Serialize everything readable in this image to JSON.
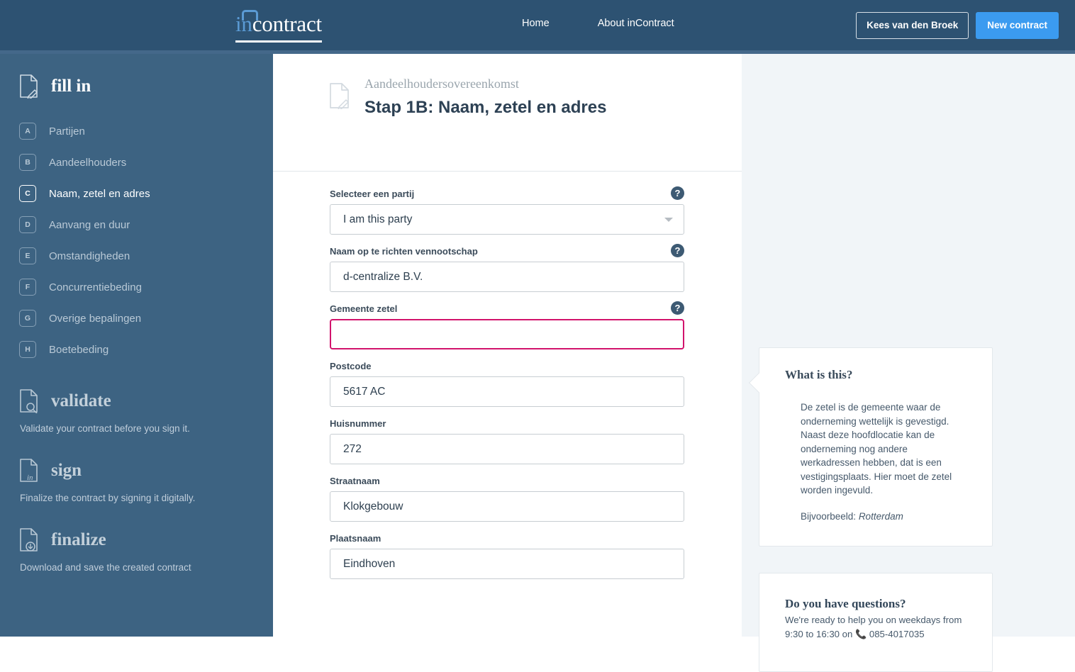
{
  "header": {
    "logo_in": "in",
    "logo_rest": "contract",
    "nav": [
      {
        "label": "Home",
        "name": "nav-home"
      },
      {
        "label": "About inContract",
        "name": "nav-about"
      }
    ],
    "account_button": "Kees van den Broek",
    "new_contract_button": "New contract"
  },
  "sidebar": {
    "fill_in": {
      "title": "fill in",
      "icon": "document-pencil-icon"
    },
    "items": [
      {
        "badge": "A",
        "label": "Partijen",
        "active": false
      },
      {
        "badge": "B",
        "label": "Aandeelhouders",
        "active": false
      },
      {
        "badge": "C",
        "label": "Naam, zetel en adres",
        "active": true
      },
      {
        "badge": "D",
        "label": "Aanvang en duur",
        "active": false
      },
      {
        "badge": "E",
        "label": "Omstandigheden",
        "active": false
      },
      {
        "badge": "F",
        "label": "Concurrentiebeding",
        "active": false
      },
      {
        "badge": "G",
        "label": "Overige bepalingen",
        "active": false
      },
      {
        "badge": "H",
        "label": "Boetebeding",
        "active": false
      }
    ],
    "validate": {
      "title": "validate",
      "description": "Validate your contract before you sign it.",
      "icon": "document-search-icon"
    },
    "sign": {
      "title": "sign",
      "description": "Finalize the contract by signing it digitally.",
      "icon": "document-signature-icon"
    },
    "finalize": {
      "title": "finalize",
      "description": "Download and save the created contract",
      "icon": "document-download-icon"
    }
  },
  "main": {
    "breadcrumb": "Aandeelhoudersovereenkomst",
    "title": "Stap 1B: Naam, zetel en adres",
    "help_glyph": "?",
    "fields": [
      {
        "label": "Selecteer een partij",
        "value": "I am this party",
        "type": "select",
        "has_help": true
      },
      {
        "label": "Naam op te richten vennootschap",
        "value": "d-centralize B.V.",
        "type": "text",
        "has_help": true
      },
      {
        "label": "Gemeente zetel",
        "value": "",
        "type": "text",
        "has_help": true,
        "highlighted": true
      },
      {
        "label": "Postcode",
        "value": "5617 AC",
        "type": "text",
        "has_help": false
      },
      {
        "label": "Huisnummer",
        "value": "272",
        "type": "text",
        "has_help": false
      },
      {
        "label": "Straatnaam",
        "value": "Klokgebouw",
        "type": "text",
        "has_help": false
      },
      {
        "label": "Plaatsnaam",
        "value": "Eindhoven",
        "type": "text",
        "has_help": false
      }
    ]
  },
  "right_panel": {
    "what_is_this": {
      "title": "What is this?",
      "body": "De zetel is de gemeente waar de onderneming wettelijk is gevestigd. Naast deze hoofdlocatie kan de onderneming nog andere werkadressen hebben, dat is een vestigingsplaats. Hier moet de zetel worden ingevuld.",
      "example_prefix": "Bijvoorbeeld: ",
      "example_value": "Rotterdam"
    },
    "questions": {
      "title": "Do you have questions?",
      "line1": "We're ready to help you on weekdays from",
      "line2_prefix": "9:30 to 16:30 on ",
      "phone_icon": "phone-icon",
      "phone": "085-4017035"
    }
  },
  "colors": {
    "header_bg": "#2d5272",
    "sidebar_bg": "#3d6382",
    "accent_blue": "#3b9bf0",
    "logo_blue": "#5b9bd5",
    "highlight_pink": "#d2136c",
    "panel_bg": "#f1f5f8"
  }
}
